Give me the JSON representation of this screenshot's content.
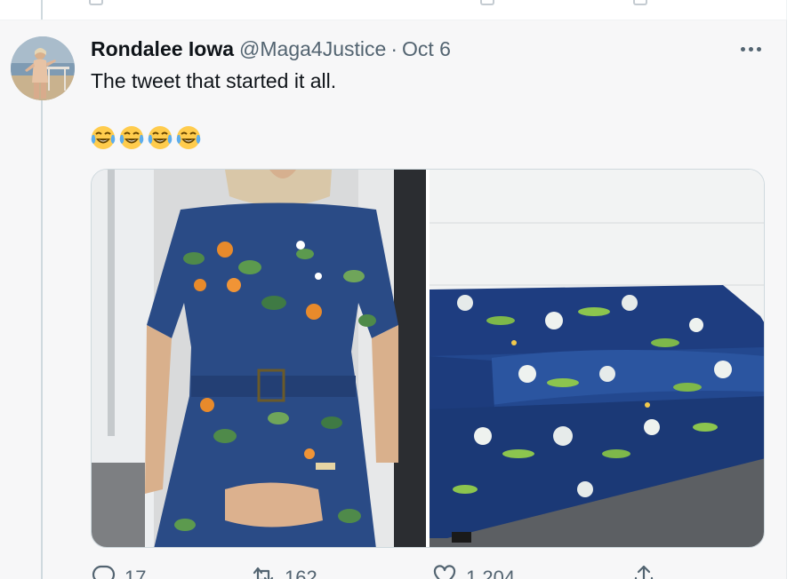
{
  "tweet": {
    "display_name": "Rondalee Iowa",
    "handle": "@Maga4Justice",
    "separator": "·",
    "date": "Oct 6",
    "text": "The tweet that started it all.",
    "emojis": [
      "😂",
      "😂",
      "😂",
      "😂"
    ],
    "media": [
      {
        "description": "photo-woman-in-blue-floral-dress",
        "palette": "#27477e"
      },
      {
        "description": "photo-blue-floral-sofa",
        "palette": "#1f3f80"
      }
    ],
    "actions": {
      "reply_count": "17",
      "retweet_count": "162",
      "like_count": "1,204"
    }
  },
  "icons": {
    "more": "more-horizontal-icon",
    "reply": "reply-icon",
    "retweet": "retweet-icon",
    "like": "heart-icon",
    "share": "share-icon"
  },
  "colors": {
    "text_primary": "#0f1419",
    "text_secondary": "#536471",
    "thread_line": "#cfd9de",
    "background_focused": "#f7f7f8"
  }
}
